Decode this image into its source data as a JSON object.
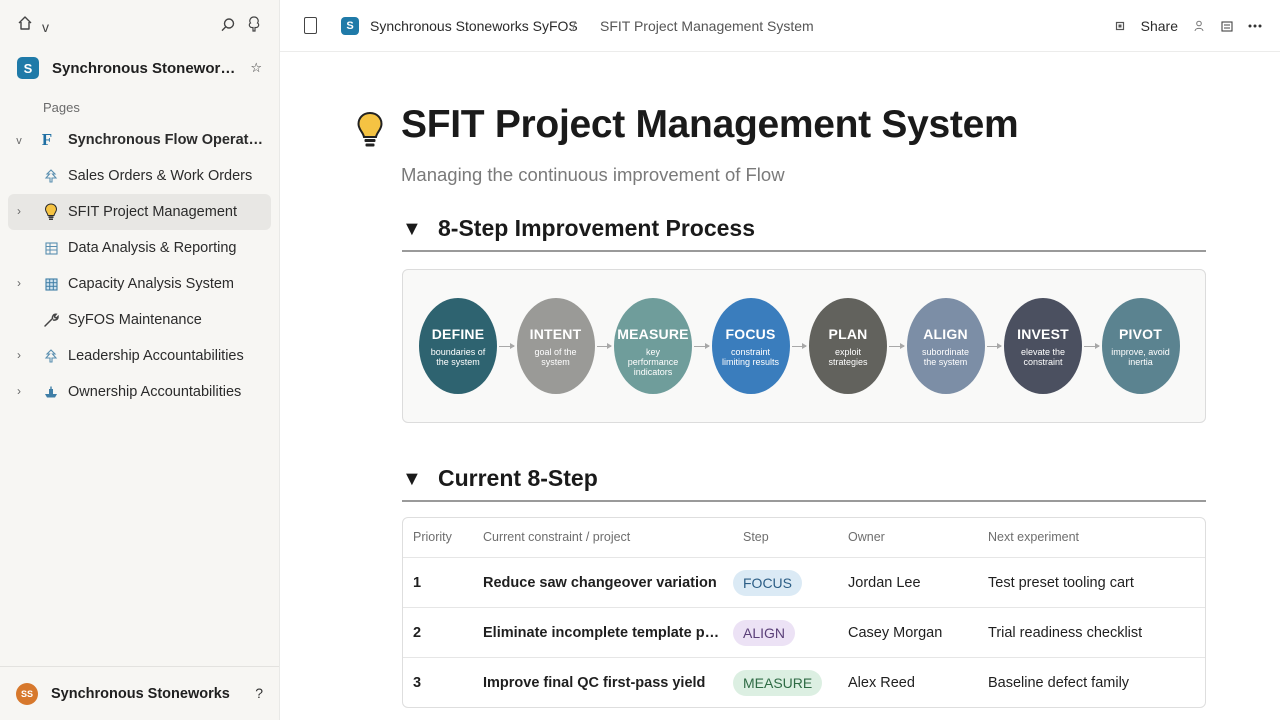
{
  "sidebar": {
    "caret": "v",
    "workspace": {
      "logo_letter": "S",
      "name": "Synchronous Stoneworks..."
    },
    "pages_label": "Pages",
    "items": [
      {
        "label": "Synchronous Flow Operati...",
        "chevron": "v",
        "icon": "letter-f-icon",
        "icon_text": "F"
      },
      {
        "label": "Sales Orders & Work Orders",
        "chevron": "",
        "icon": "tree-icon"
      },
      {
        "label": "SFIT Project Management",
        "chevron": "›",
        "icon": "lightbulb-icon"
      },
      {
        "label": "Data Analysis & Reporting",
        "chevron": "",
        "icon": "table-icon"
      },
      {
        "label": "Capacity Analysis System",
        "chevron": "›",
        "icon": "grid-icon"
      },
      {
        "label": "SyFOS Maintenance",
        "chevron": "",
        "icon": "wrench-icon"
      },
      {
        "label": "Leadership Accountabilities",
        "chevron": "›",
        "icon": "tree-icon"
      },
      {
        "label": "Ownership Accountabilities",
        "chevron": "›",
        "icon": "ship-icon"
      }
    ],
    "footer": {
      "avatar_initials": "SS",
      "name": "Synchronous Stoneworks",
      "help": "?"
    }
  },
  "topbar": {
    "logo_letter": "S",
    "breadcrumb": [
      "Synchronous Stoneworks SyFOS",
      "SFIT Project Management System"
    ],
    "separator": "/",
    "share_label": "Share"
  },
  "page": {
    "title": "SFIT Project Management System",
    "subtitle": "Managing the continuous improvement of Flow"
  },
  "process_section": {
    "toggle": "▼",
    "heading": "8-Step Improvement Process",
    "steps": [
      {
        "title": "DEFINE",
        "sub1": "boundaries of",
        "sub2": "the system",
        "color": "#2e6370"
      },
      {
        "title": "INTENT",
        "sub1": "goal of the",
        "sub2": "system",
        "color": "#9a9a97"
      },
      {
        "title": "MEASURE",
        "sub1": "key performance",
        "sub2": "indicators",
        "color": "#6f9d9b"
      },
      {
        "title": "FOCUS",
        "sub1": "constraint",
        "sub2": "limiting results",
        "color": "#3a7dbd"
      },
      {
        "title": "PLAN",
        "sub1": "exploit",
        "sub2": "strategies",
        "color": "#62625d"
      },
      {
        "title": "ALIGN",
        "sub1": "subordinate",
        "sub2": "the system",
        "color": "#7c8ea6"
      },
      {
        "title": "INVEST",
        "sub1": "elevate the",
        "sub2": "constraint",
        "color": "#4b5060"
      },
      {
        "title": "PIVOT",
        "sub1": "improve, avoid",
        "sub2": "inertia",
        "color": "#5b8390"
      }
    ]
  },
  "current_section": {
    "toggle": "▼",
    "heading": "Current 8-Step",
    "columns": [
      "Priority",
      "Current constraint / project",
      "Step",
      "Owner",
      "Next experiment"
    ],
    "rows": [
      {
        "priority": "1",
        "project": "Reduce saw changeover variation",
        "step": "FOCUS",
        "step_bg": "#dbeaf5",
        "step_fg": "#2c5e86",
        "owner": "Jordan Lee",
        "next": "Test preset tooling cart"
      },
      {
        "priority": "2",
        "project": "Eliminate incomplete template pa...",
        "step": "ALIGN",
        "step_bg": "#ece2f5",
        "step_fg": "#5a3f78",
        "owner": "Casey Morgan",
        "next": "Trial readiness checklist"
      },
      {
        "priority": "3",
        "project": "Improve final QC first-pass yield",
        "step": "MEASURE",
        "step_bg": "#dcefe2",
        "step_fg": "#2f6b45",
        "owner": "Alex Reed",
        "next": "Baseline defect family"
      }
    ]
  }
}
